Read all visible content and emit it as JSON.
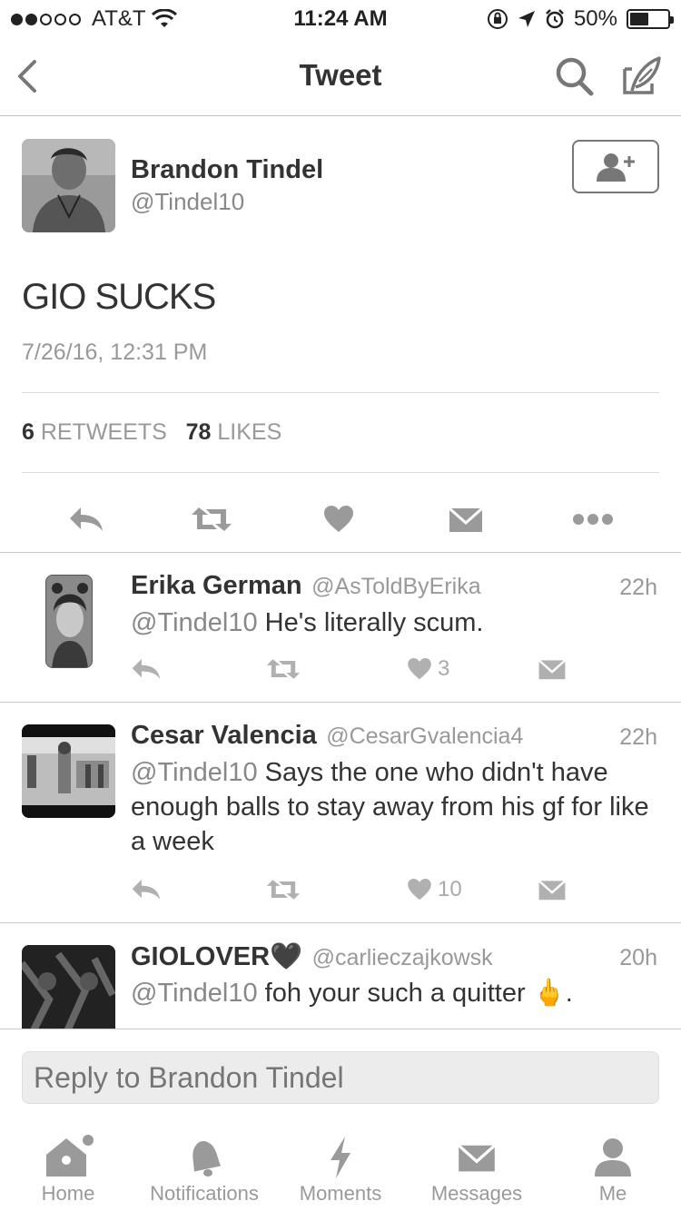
{
  "status_bar": {
    "carrier": "AT&T",
    "time": "11:24 AM",
    "battery": "50%",
    "battery_level": 0.5
  },
  "nav": {
    "title": "Tweet"
  },
  "tweet": {
    "author_name": "Brandon Tindel",
    "author_handle": "@Tindel10",
    "text": "GIO SUCKS",
    "timestamp": "7/26/16, 12:31 PM",
    "retweets_count": "6",
    "retweets_label": "RETWEETS",
    "likes_count": "78",
    "likes_label": "LIKES"
  },
  "replies": [
    {
      "name": "Erika German",
      "handle": "@AsToldByErika",
      "time": "22h",
      "mention": "@Tindel10",
      "text": " He's literally scum.",
      "likes": "3"
    },
    {
      "name": "Cesar Valencia",
      "handle": "@CesarGvalencia4",
      "time": "22h",
      "mention": "@Tindel10",
      "text": " Says the one who didn't have enough balls to stay away from his gf for like a week",
      "likes": "10"
    },
    {
      "name": "GIOLOVER🖤",
      "handle": "@carlieczajkowsk",
      "time": "20h",
      "mention": "@Tindel10",
      "text": " foh your such a quitter 🖕.",
      "likes": ""
    }
  ],
  "reply_box": {
    "placeholder": "Reply to Brandon Tindel"
  },
  "tabs": [
    {
      "label": "Home",
      "icon": "home-icon"
    },
    {
      "label": "Notifications",
      "icon": "bell-icon"
    },
    {
      "label": "Moments",
      "icon": "lightning-icon"
    },
    {
      "label": "Messages",
      "icon": "envelope-icon"
    },
    {
      "label": "Me",
      "icon": "person-icon"
    }
  ],
  "colors": {
    "icon_gray": "#9a9a9a",
    "text_dark": "#333333",
    "text_muted": "#999999"
  }
}
